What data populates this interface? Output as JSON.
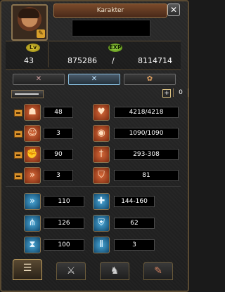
{
  "window": {
    "title": "Karakter"
  },
  "header": {
    "level_badge": "Lv",
    "exp_badge": "EXP",
    "level": "43",
    "exp_current": "875286",
    "exp_separator": "/",
    "exp_required": "8114714"
  },
  "tabs": [
    {
      "icon": "crossed-swords-icon",
      "label": "✕"
    },
    {
      "icon": "crossed-swords-blue-icon",
      "label": "✕"
    },
    {
      "icon": "ornament-icon",
      "label": "✿"
    }
  ],
  "stat_points": {
    "plus_label": "+",
    "value": "0"
  },
  "primary_stats": [
    {
      "icon": "body-icon",
      "value": "48",
      "derived_icon": "heart-icon",
      "derived_value": "4218/4218"
    },
    {
      "icon": "head-icon",
      "value": "3",
      "derived_icon": "mana-orb-icon",
      "derived_value": "1090/1090"
    },
    {
      "icon": "fist-icon",
      "value": "90",
      "derived_icon": "sword-icon",
      "derived_value": "293-308"
    },
    {
      "icon": "running-icon",
      "value": "3",
      "derived_icon": "shield-icon",
      "derived_value": "81"
    }
  ],
  "secondary_stats": [
    {
      "icon": "speed-icon",
      "value": "110",
      "right_icon": "magic-attack-icon",
      "right_value": "144-160"
    },
    {
      "icon": "claw-icon",
      "value": "126",
      "right_icon": "magic-defense-icon",
      "right_value": "62"
    },
    {
      "icon": "hourglass-icon",
      "value": "100",
      "right_icon": "pillar-icon",
      "right_value": "3"
    }
  ],
  "bottom_tabs": [
    {
      "icon": "character-card-icon",
      "active": true
    },
    {
      "icon": "sword-skill-icon",
      "active": false
    },
    {
      "icon": "mount-icon",
      "active": false
    },
    {
      "icon": "scroll-icon",
      "active": false
    }
  ]
}
